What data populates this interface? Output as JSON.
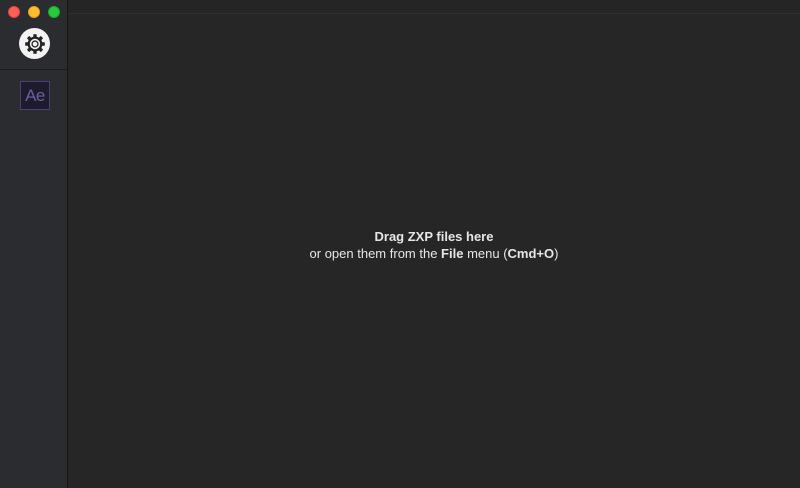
{
  "window": {
    "controls": [
      "close",
      "minimize",
      "maximize"
    ]
  },
  "sidebar": {
    "settings_icon": "gear-icon",
    "apps": [
      {
        "label": "Ae",
        "color": "#4b3f73"
      }
    ]
  },
  "main": {
    "drop_title": "Drag ZXP files here",
    "drop_line_prefix": "or open them from the ",
    "drop_file": "File",
    "drop_middle": " menu (",
    "drop_shortcut": "Cmd+O",
    "drop_suffix": ")"
  },
  "colors": {
    "background": "#262626",
    "sidebar": "#2b2c2f",
    "text": "#e6e6e6"
  }
}
